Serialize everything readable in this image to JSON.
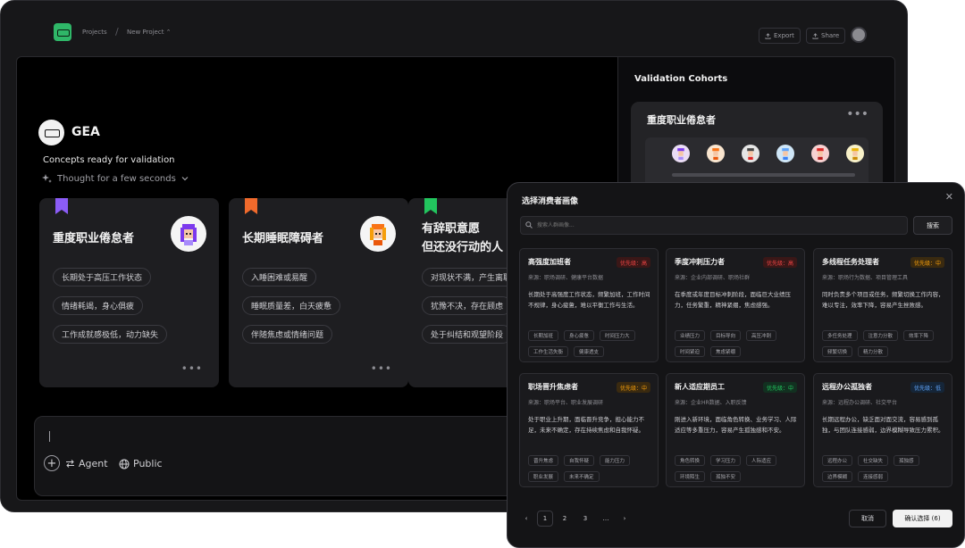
{
  "topbar": {
    "crumb_projects": "Projects",
    "crumb_sep": "/",
    "crumb_project": "New Project ⌃",
    "export_label": "Export",
    "share_label": "Share"
  },
  "brand": {
    "name": "GEA"
  },
  "status": {
    "concepts": "Concepts ready for validation",
    "thought": "Thought for a few seconds"
  },
  "cards": [
    {
      "title": "重度职业倦怠者",
      "bookmark_color": "#8b5cf6",
      "tags": [
        "长期处于高压工作状态",
        "情绪耗竭，身心俱疲",
        "工作成就感极低，动力缺失"
      ],
      "more": "•••"
    },
    {
      "title": "长期睡眠障碍者",
      "bookmark_color": "#f06a2c",
      "tags": [
        "入睡困难或易醒",
        "睡眠质量差，白天疲惫",
        "伴随焦虑或情绪问题"
      ],
      "more": "•••"
    },
    {
      "title_line1": "有辞职意愿",
      "title_line2": "但还没行动的人",
      "bookmark_color": "#22c55e",
      "tags": [
        "对现状不满，产生离职",
        "犹豫不决，存在顾虑",
        "处于纠结和观望阶段"
      ]
    }
  ],
  "prompt": {
    "agent_label": "Agent",
    "public_label": "Public"
  },
  "right_panel": {
    "title": "Validation Cohorts",
    "cohort_title": "重度职业倦怠者",
    "cohort_more": "•••"
  },
  "modal": {
    "title": "选择消费者画像",
    "search_placeholder": "搜索人群画像...",
    "search_button": "搜索",
    "cards": [
      {
        "name": "高强度加班者",
        "badge": "优先级：高",
        "badge_level": "high",
        "source": "来源：职场调研、健康平台数据",
        "desc": "长期处于高强度工作状态，频繁加班，工作时间不规律，身心疲惫，难以平衡工作与生活。",
        "tags": [
          "长期加班",
          "身心疲惫",
          "时间压力大",
          "工作生活失衡",
          "健康透支"
        ]
      },
      {
        "name": "季度冲刺压力者",
        "badge": "优先级：高",
        "badge_level": "high",
        "source": "来源：企业内部调研、职场社群",
        "desc": "在季度或年度目标冲刺阶段，面临巨大业绩压力，任务繁重，精神紧绷，焦虑感强。",
        "tags": [
          "业绩压力",
          "目标导向",
          "高压冲刺",
          "时间紧迫",
          "焦虑紧绷"
        ]
      },
      {
        "name": "多线程任务处理者",
        "badge": "优先级：中",
        "badge_level": "mid",
        "source": "来源：职场行为数据、项目管理工具",
        "desc": "同时负责多个项目或任务，频繁切换工作内容，难以专注，效率下降，容易产生挫败感。",
        "tags": [
          "多任务处理",
          "注意力分散",
          "效率下降",
          "频繁切换",
          "精力分散"
        ]
      },
      {
        "name": "职场晋升焦虑者",
        "badge": "优先级：中",
        "badge_level": "mid",
        "source": "来源：职场平台、职业发展调研",
        "desc": "处于职业上升期，面临晋升竞争，担心能力不足，未来不确定，存在持续焦虑和自我怀疑。",
        "tags": [
          "晋升焦虑",
          "自我怀疑",
          "能力压力",
          "职业发展",
          "未来不确定"
        ]
      },
      {
        "name": "新人适应期员工",
        "badge": "优先级：中",
        "badge_level": "green",
        "source": "来源：企业HR数据、入职反馈",
        "desc": "刚进入新环境，面临角色转换、业务学习、人际适应等多重压力，容易产生孤独感和不安。",
        "tags": [
          "角色转换",
          "学习压力",
          "人际适应",
          "环境陌生",
          "孤独不安"
        ]
      },
      {
        "name": "远程办公孤独者",
        "badge": "优先级：低",
        "badge_level": "low",
        "source": "来源：远程办公调研、社交平台",
        "desc": "长期远程办公，缺乏面对面交流，容易感到孤独，与团队连接感弱，边界模糊导致压力累积。",
        "tags": [
          "远程办公",
          "社交缺失",
          "孤独感",
          "边界模糊",
          "连接感弱"
        ]
      }
    ],
    "pagination": {
      "prev": "‹",
      "pages": [
        "1",
        "2",
        "3"
      ],
      "ellipsis": "…",
      "next": "›",
      "current": "1"
    },
    "cancel": "取消",
    "confirm": "确认选择 (6)"
  },
  "colors": {
    "badge_high_bg": "#3a1717",
    "badge_high_fg": "#ef4444",
    "badge_mid_bg": "#3a2a10",
    "badge_mid_fg": "#f59e0b",
    "badge_green_bg": "#123020",
    "badge_green_fg": "#22c55e",
    "badge_low_bg": "#152538",
    "badge_low_fg": "#60a5fa"
  }
}
